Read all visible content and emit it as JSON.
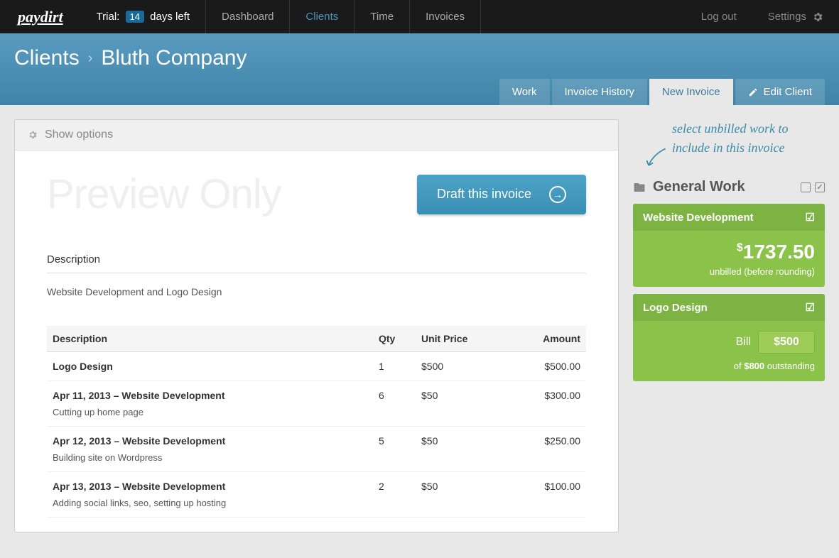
{
  "logo": "paydirt",
  "trial": {
    "prefix": "Trial:",
    "days": "14",
    "suffix": "days left"
  },
  "nav": {
    "dashboard": "Dashboard",
    "clients": "Clients",
    "time": "Time",
    "invoices": "Invoices",
    "logout": "Log out",
    "settings": "Settings"
  },
  "breadcrumb": {
    "root": "Clients",
    "current": "Bluth Company"
  },
  "tabs": {
    "work": "Work",
    "history": "Invoice History",
    "new": "New Invoice",
    "edit": "Edit Client"
  },
  "options": "Show options",
  "watermark": "Preview Only",
  "draft_btn": "Draft this invoice",
  "description": {
    "label": "Description",
    "text": "Website Development and Logo Design"
  },
  "table": {
    "headers": {
      "desc": "Description",
      "qty": "Qty",
      "unit": "Unit Price",
      "amount": "Amount"
    },
    "rows": [
      {
        "title": "Logo Design",
        "sub": "",
        "qty": "1",
        "unit": "$500",
        "amount": "$500.00"
      },
      {
        "title": "Apr 11, 2013 – Website Development",
        "sub": "Cutting up home page",
        "qty": "6",
        "unit": "$50",
        "amount": "$300.00"
      },
      {
        "title": "Apr 12, 2013 – Website Development",
        "sub": "Building site on Wordpress",
        "qty": "5",
        "unit": "$50",
        "amount": "$250.00"
      },
      {
        "title": "Apr 13, 2013 – Website Development",
        "sub": "Adding social links, seo, setting up hosting",
        "qty": "2",
        "unit": "$50",
        "amount": "$100.00"
      }
    ]
  },
  "hint": "select unbilled work to include in this invoice",
  "group": "General Work",
  "cards": {
    "webdev": {
      "title": "Website Development",
      "amount": "1737.50",
      "note": "unbilled (before rounding)"
    },
    "logo": {
      "title": "Logo Design",
      "bill_label": "Bill",
      "bill_value": "$500",
      "of": "of",
      "out_amount": "$800",
      "out_text": "outstanding"
    }
  }
}
